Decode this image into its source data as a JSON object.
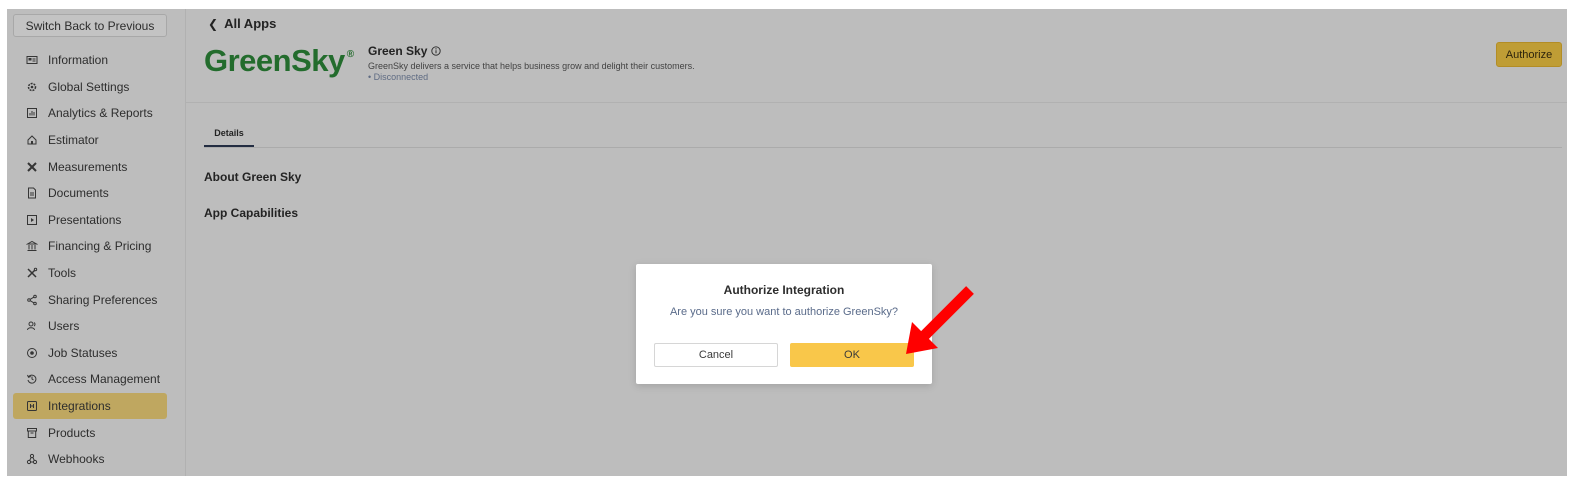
{
  "sidebar": {
    "switch_label": "Switch Back to Previous",
    "items": [
      {
        "label": "Information",
        "icon": "id-card-icon"
      },
      {
        "label": "Global Settings",
        "icon": "gear-icon"
      },
      {
        "label": "Analytics & Reports",
        "icon": "chart-icon"
      },
      {
        "label": "Estimator",
        "icon": "home-icon"
      },
      {
        "label": "Measurements",
        "icon": "ruler-cross-icon"
      },
      {
        "label": "Documents",
        "icon": "document-icon"
      },
      {
        "label": "Presentations",
        "icon": "play-icon"
      },
      {
        "label": "Financing & Pricing",
        "icon": "bank-icon"
      },
      {
        "label": "Tools",
        "icon": "tools-icon"
      },
      {
        "label": "Sharing Preferences",
        "icon": "share-icon"
      },
      {
        "label": "Users",
        "icon": "users-icon"
      },
      {
        "label": "Job Statuses",
        "icon": "status-icon"
      },
      {
        "label": "Access Management",
        "icon": "history-icon"
      },
      {
        "label": "Integrations",
        "icon": "integrations-icon",
        "active": true
      },
      {
        "label": "Products",
        "icon": "box-icon"
      },
      {
        "label": "Webhooks",
        "icon": "webhook-icon"
      }
    ]
  },
  "header": {
    "back_label": "All Apps",
    "logo_text": "GreenSky",
    "logo_mark": "®",
    "app_name": "Green Sky",
    "description": "GreenSky delivers a service that helps business grow and delight their customers.",
    "status": "• Disconnected",
    "authorize_label": "Authorize"
  },
  "tabs": [
    {
      "label": "Details",
      "active": true
    }
  ],
  "sections": {
    "about": "About Green Sky",
    "capabilities": "App Capabilities"
  },
  "modal": {
    "title": "Authorize Integration",
    "message": "Are you sure you want to authorize GreenSky?",
    "cancel_label": "Cancel",
    "ok_label": "OK"
  },
  "colors": {
    "accent": "#f9c74a",
    "active_nav": "#f5d77c",
    "logo_green": "#2e8b3a",
    "annotation_arrow": "#ff0000"
  }
}
